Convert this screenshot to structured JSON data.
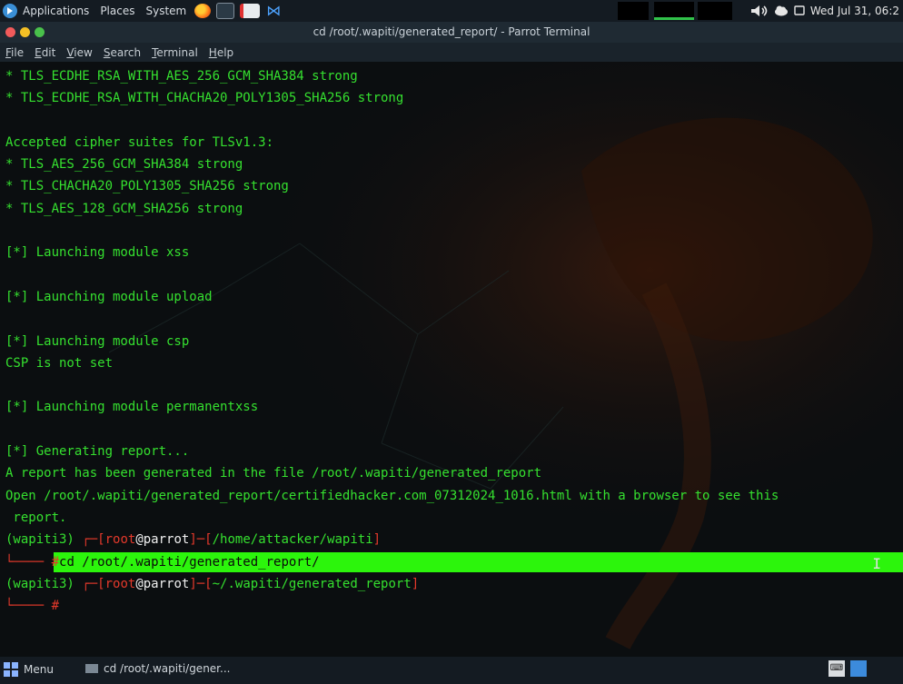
{
  "top_panel": {
    "menus": [
      "Applications",
      "Places",
      "System"
    ],
    "datetime": "Wed Jul 31, 06:2"
  },
  "window": {
    "title": "cd /root/.wapiti/generated_report/ - Parrot Terminal"
  },
  "menubar": {
    "items": [
      {
        "label": "File",
        "u": "F",
        "rest": "ile"
      },
      {
        "label": "Edit",
        "u": "E",
        "rest": "dit"
      },
      {
        "label": "View",
        "u": "V",
        "rest": "iew"
      },
      {
        "label": "Search",
        "u": "S",
        "rest": "earch"
      },
      {
        "label": "Terminal",
        "u": "T",
        "rest": "erminal"
      },
      {
        "label": "Help",
        "u": "H",
        "rest": "elp"
      }
    ]
  },
  "terminal": {
    "lines": [
      "* TLS_ECDHE_RSA_WITH_AES_256_GCM_SHA384 strong",
      "* TLS_ECDHE_RSA_WITH_CHACHA20_POLY1305_SHA256 strong",
      "",
      "Accepted cipher suites for TLSv1.3:",
      "* TLS_AES_256_GCM_SHA384 strong",
      "* TLS_CHACHA20_POLY1305_SHA256 strong",
      "* TLS_AES_128_GCM_SHA256 strong",
      "",
      "[*] Launching module xss",
      "",
      "[*] Launching module upload",
      "",
      "[*] Launching module csp",
      "CSP is not set",
      "",
      "[*] Launching module permanentxss",
      "",
      "[*] Generating report...",
      "A report has been generated in the file /root/.wapiti/generated_report",
      "Open /root/.wapiti/generated_report/certifiedhacker.com_07312024_1016.html with a browser to see this",
      " report."
    ],
    "prompt1": {
      "venv": "(wapiti3) ",
      "open": "┌─[",
      "user": "root",
      "at": "@",
      "host": "parrot",
      "mid": "]─[",
      "path": "/home/attacker/wapiti",
      "close": "]"
    },
    "cmd1": {
      "prefix": "└──── #",
      "command": "cd /root/.wapiti/generated_report/"
    },
    "prompt2": {
      "venv": "(wapiti3) ",
      "open": "┌─[",
      "user": "root",
      "at": "@",
      "host": "parrot",
      "mid": "]─[",
      "path": "~/.wapiti/generated_report",
      "close": "]"
    },
    "cmd2": {
      "prefix": "└──── #"
    }
  },
  "bottom_panel": {
    "menu_label": "Menu",
    "task_label": "cd /root/.wapiti/gener..."
  },
  "colors": {
    "terminal_text": "#35e02f",
    "prompt_red": "#e4392b",
    "selection_green": "#2cf50c"
  }
}
